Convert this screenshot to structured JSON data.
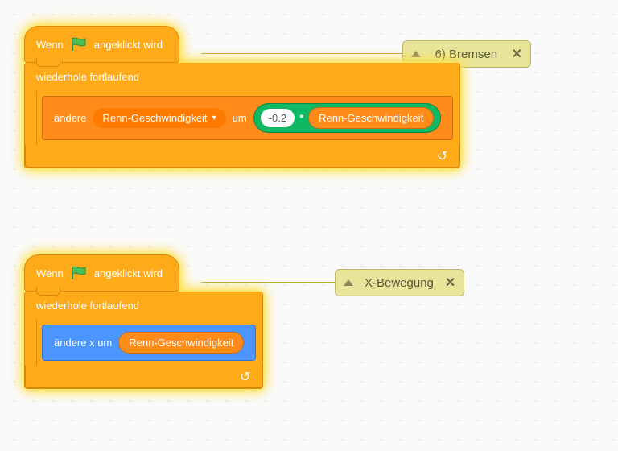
{
  "script1": {
    "hat_prefix": "Wenn",
    "hat_suffix": "angeklickt wird",
    "loop_label": "wiederhole fortlaufend",
    "change_prefix": "ändere",
    "change_var": "Renn-Geschwindigkeit",
    "change_mid": "um",
    "op_left": "-0.2",
    "op_sym": "*",
    "op_right": "Renn-Geschwindigkeit",
    "comment": "6) Bremsen"
  },
  "script2": {
    "hat_prefix": "Wenn",
    "hat_suffix": "angeklickt wird",
    "loop_label": "wiederhole fortlaufend",
    "changex_prefix": "ändere x um",
    "changex_var": "Renn-Geschwindigkeit",
    "comment": "X-Bewegung"
  }
}
